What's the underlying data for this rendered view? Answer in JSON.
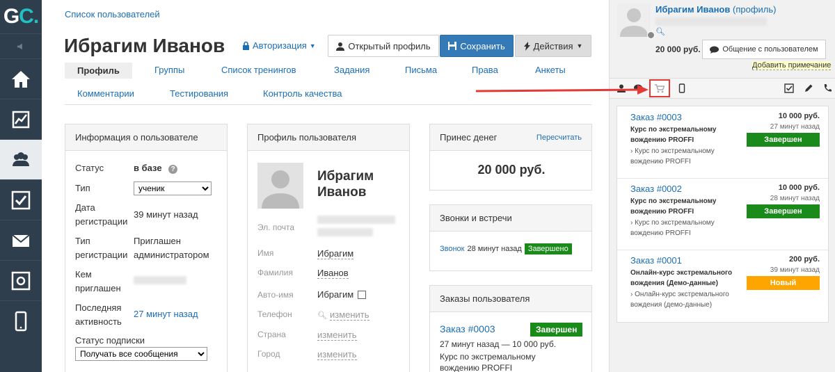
{
  "logo": {
    "g": "G",
    "c": "C."
  },
  "breadcrumb": "Список пользователей",
  "page_title": "Ибрагим Иванов",
  "auth_label": "Авторизация",
  "buttons": {
    "open_profile": "Открытый профиль",
    "save": "Сохранить",
    "actions": "Действия"
  },
  "tabs": [
    "Профиль",
    "Группы",
    "Список тренингов",
    "Задания",
    "Письма",
    "Права",
    "Анкеты",
    "Комментарии",
    "Тестирования",
    "Контроль качества"
  ],
  "info_panel": {
    "title": "Информация о пользователе",
    "status_label": "Статус",
    "status_value": "в базе",
    "type_label": "Тип",
    "type_value": "ученик",
    "reg_date_label_1": "Дата",
    "reg_date_label_2": "регистрации",
    "reg_date_value": "39 минут назад",
    "reg_type_label_1": "Тип",
    "reg_type_label_2": "регистрации",
    "reg_type_value_1": "Приглашен",
    "reg_type_value_2": "администратором",
    "invited_label_1": "Кем",
    "invited_label_2": "приглашен",
    "last_active_label_1": "Последняя",
    "last_active_label_2": "активность",
    "last_active_value": "27 минут назад",
    "subscription_label": "Статус подписки",
    "subscription_value": "Получать все сообщения"
  },
  "profile_panel": {
    "title": "Профиль пользователя",
    "first": "Ибрагим",
    "last": "Иванов",
    "email_label": "Эл. почта",
    "name_label": "Имя",
    "name_value": "Ибрагим",
    "surname_label": "Фамилия",
    "surname_value": "Иванов",
    "autoname_label": "Авто-имя",
    "autoname_value": "Ибрагим",
    "phone_label": "Телефон",
    "phone_value": "изменить",
    "country_label": "Страна",
    "country_value": "изменить",
    "city_label": "Город",
    "city_value": "изменить"
  },
  "money_panel": {
    "title": "Принес денег",
    "recalc": "Пересчитать",
    "amount": "20 000 руб."
  },
  "calls_panel": {
    "title": "Звонки и встречи",
    "call_link": "Звонок",
    "call_time": "28 минут назад",
    "call_status": "Завершено"
  },
  "orders_panel": {
    "title": "Заказы пользователя",
    "order_link": "Заказ #0003",
    "order_status": "Завершен",
    "order_info": "27 минут назад — 10 000 руб.",
    "order_desc_1": "Курс по экстремальному",
    "order_desc_2": "вождению PROFFI"
  },
  "right_panel": {
    "name": "Ибрагим Иванов",
    "profile_link": "(профиль)",
    "money": "20 000 руб.",
    "chat": "Общение с пользователем",
    "add_note": "Добавить примечание",
    "orders": [
      {
        "link": "Заказ #0003",
        "price": "10 000 руб.",
        "time": "27 минут назад",
        "title": "Курс по экстремальному вождению PROFFI",
        "sub": "› Курс по экстремальному вождению PROFFI",
        "status": "Завершен",
        "color": "#1a8a1a"
      },
      {
        "link": "Заказ #0002",
        "price": "10 000 руб.",
        "time": "28 минут назад",
        "title": "Курс по экстремальному вождению PROFFI",
        "sub": "› Курс по экстремальному вождению PROFFI",
        "status": "Завершен",
        "color": "#1a8a1a"
      },
      {
        "link": "Заказ #0001",
        "price": "200 руб.",
        "time": "39 минут назад",
        "title": "Онлайн-курс экстремального вождения (Демо-данные)",
        "sub": "› Онлайн-курс экстремального вождения (демо-данные)",
        "status": "Новый",
        "color": "#ffa500"
      }
    ]
  },
  "colors": {
    "accent": "#1b6eb5",
    "sidebar": "#2f3e4d",
    "save": "#337ab7",
    "success": "#1a8a1a",
    "new": "#ffa500",
    "highlight": "#e53935"
  }
}
